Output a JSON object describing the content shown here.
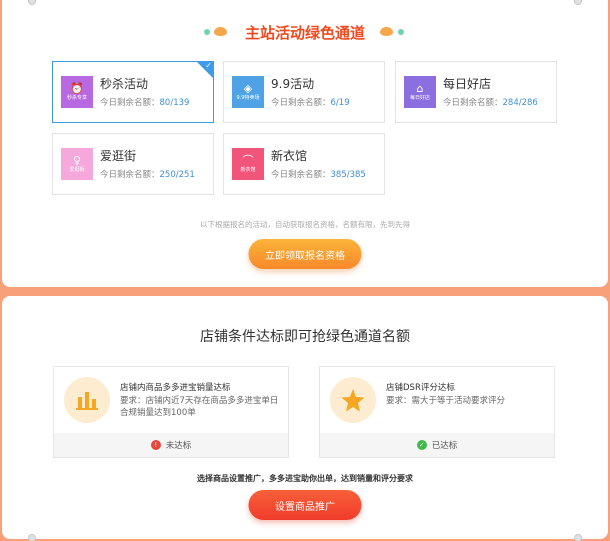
{
  "header": {
    "title": "主站活动绿色通道"
  },
  "activities": [
    {
      "name": "秒杀活动",
      "icon": "alarm-clock-icon",
      "icon_caption": "秒杀专享",
      "icon_color": "#b868e0",
      "quota_label": "今日剩余名额：",
      "quota": "80/139",
      "selected": true
    },
    {
      "name": "9.9活动",
      "icon": "tag-icon",
      "icon_caption": "9.9特卖场",
      "icon_color": "#4fa2e6",
      "quota_label": "今日剩余名额：",
      "quota": "6/19",
      "selected": false
    },
    {
      "name": "每日好店",
      "icon": "store-icon",
      "icon_caption": "每日好店",
      "icon_color": "#8b6fe0",
      "quota_label": "今日剩余名额：",
      "quota": "284/286",
      "selected": false
    },
    {
      "name": "爱逛街",
      "icon": "dress-icon",
      "icon_caption": "爱逛街",
      "icon_color": "#f6a8dc",
      "quota_label": "今日剩余名额：",
      "quota": "250/251",
      "selected": false
    },
    {
      "name": "新衣馆",
      "icon": "hanger-icon",
      "icon_caption": "新衣馆",
      "icon_color": "#f2557a",
      "quota_label": "今日剩余名额：",
      "quota": "385/385",
      "selected": false
    }
  ],
  "hint": "以下根据报名的活动，自动获取报名资格，名额有限，先到先得",
  "claim_button": "立即领取报名资格",
  "conditions_title": "店铺条件达标即可抢绿色通道名额",
  "conditions": [
    {
      "title": "店铺内商品多多进宝销量达标",
      "desc": "要求：店铺内近7天存在商品多多进宝单日合规销量达到100单",
      "status": "未达标",
      "status_color": "#e8453c",
      "status_icon": "warning-icon",
      "icon": "bar-chart-icon"
    },
    {
      "title": "店铺DSR评分达标",
      "desc": "要求：需大于等于活动要求评分",
      "status": "已达标",
      "status_color": "#3fba4a",
      "status_icon": "check-icon",
      "icon": "star-icon"
    }
  ],
  "tip": "选择商品设置推广，多多进宝助你出单，达到销量和评分要求",
  "promote_button": "设置商品推广"
}
